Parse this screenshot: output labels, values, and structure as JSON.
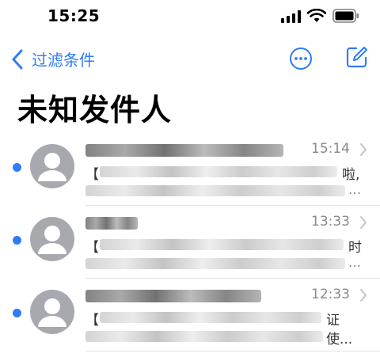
{
  "status_bar": {
    "time": "15:25"
  },
  "nav": {
    "back_label": "过滤条件"
  },
  "page": {
    "title": "未知发件人"
  },
  "mails": [
    {
      "time": "15:14",
      "subject_open": "【",
      "subject_tail": "啦,",
      "preview_tail": "..."
    },
    {
      "time": "13:33",
      "subject_open": "【",
      "subject_tail": "时",
      "preview_tail": "..."
    },
    {
      "time": "12:33",
      "subject_open": "【",
      "subject_tail": "证",
      "preview_tail": "使..."
    }
  ],
  "colors": {
    "accent": "#2f7cf6",
    "avatar": "#a8a9ae",
    "secondary_text": "#8a8a8e"
  },
  "icons": [
    "signal-icon",
    "wifi-icon",
    "battery-icon",
    "chevron-left-icon",
    "more-icon",
    "compose-icon",
    "person-icon",
    "chevron-right-icon"
  ]
}
